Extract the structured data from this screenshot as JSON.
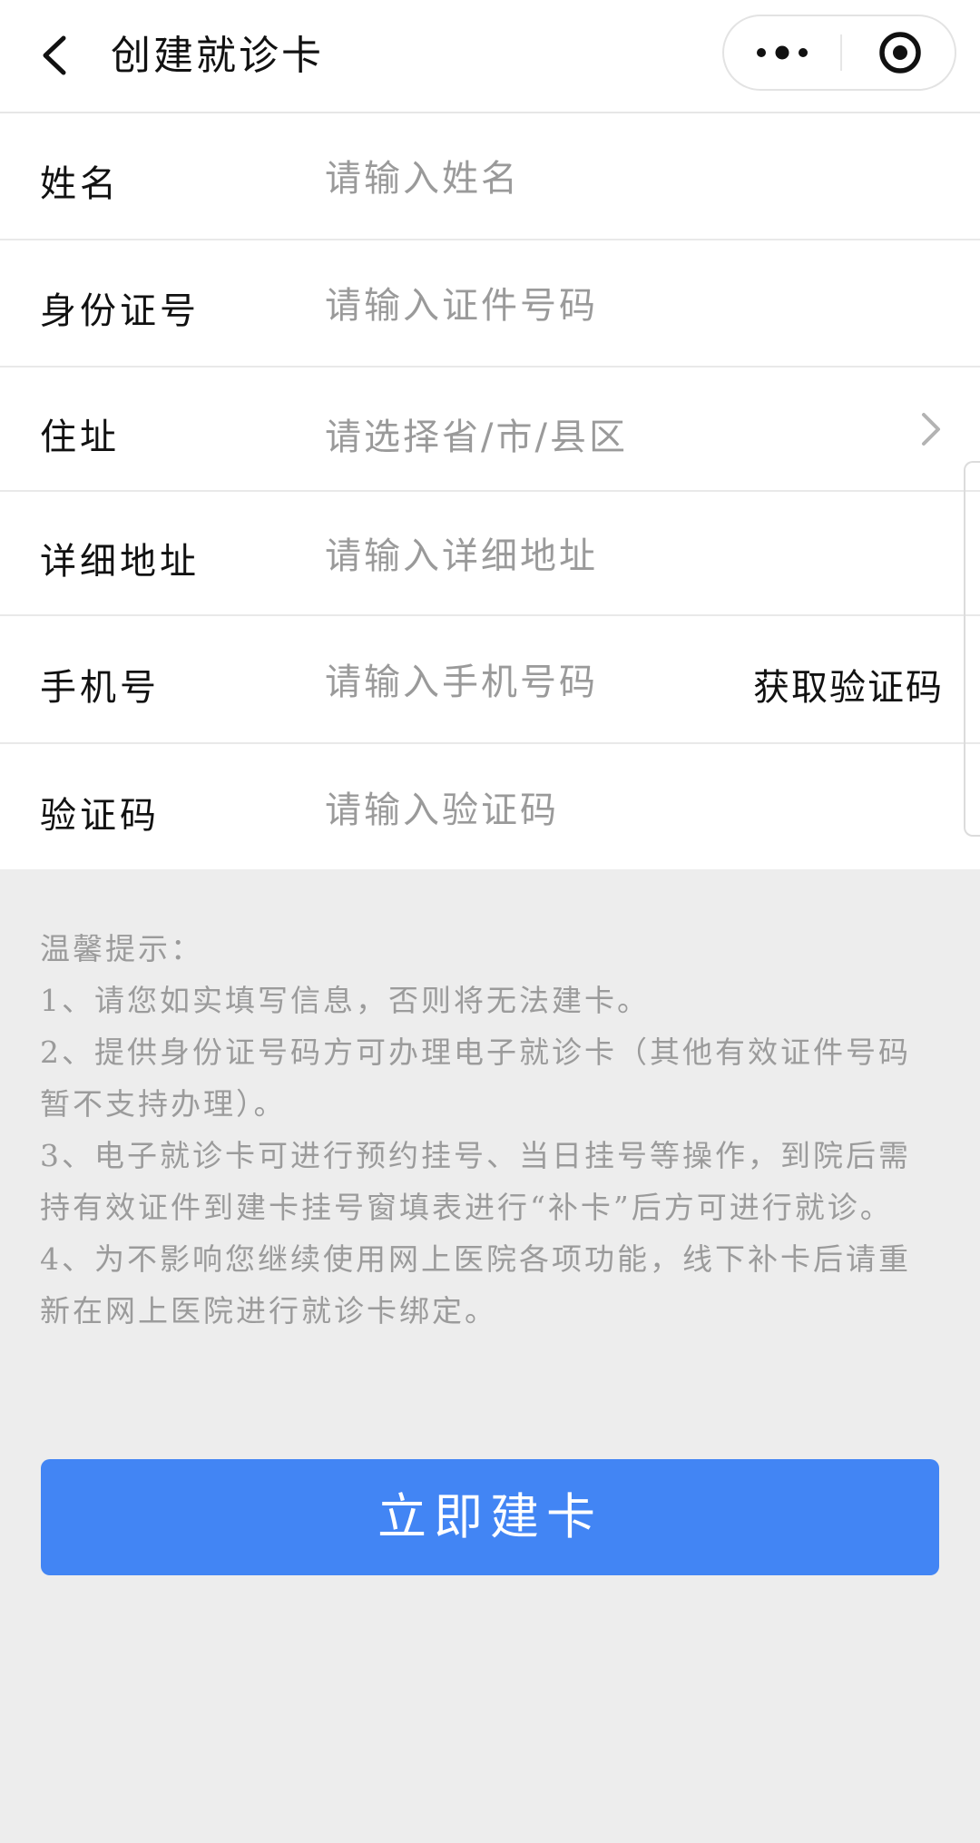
{
  "nav": {
    "title": "创建就诊卡",
    "back_icon": "chevron-left-icon",
    "more_icon": "more-dots-icon",
    "close_icon": "target-circle-icon"
  },
  "form": {
    "name": {
      "label": "姓名",
      "placeholder": "请输入姓名",
      "value": ""
    },
    "id_number": {
      "label": "身份证号",
      "placeholder": "请输入证件号码",
      "value": ""
    },
    "address": {
      "label": "住址",
      "placeholder": "请选择省/市/县区",
      "icon": "chevron-right-icon"
    },
    "detail_address": {
      "label": "详细地址",
      "placeholder": "请输入详细地址",
      "value": ""
    },
    "phone": {
      "label": "手机号",
      "placeholder": "请输入手机号码",
      "value": "",
      "get_code_label": "获取验证码"
    },
    "code": {
      "label": "验证码",
      "placeholder": "请输入验证码",
      "value": ""
    }
  },
  "tips": {
    "title": "温馨提示：",
    "items": [
      "1、请您如实填写信息，否则将无法建卡。",
      "2、提供身份证号码方可办理电子就诊卡（其他有效证件号码暂不支持办理）。",
      "3、电子就诊卡可进行预约挂号、当日挂号等操作，到院后需持有效证件到建卡挂号窗填表进行“补卡”后方可进行就诊。",
      "4、为不影响您继续使用网上医院各项功能，线下补卡后请重新在网上医院进行就诊卡绑定。"
    ]
  },
  "submit": {
    "label": "立即建卡"
  },
  "colors": {
    "accent": "#4285f4",
    "background": "#ededed",
    "placeholder": "#9a9a9a"
  }
}
